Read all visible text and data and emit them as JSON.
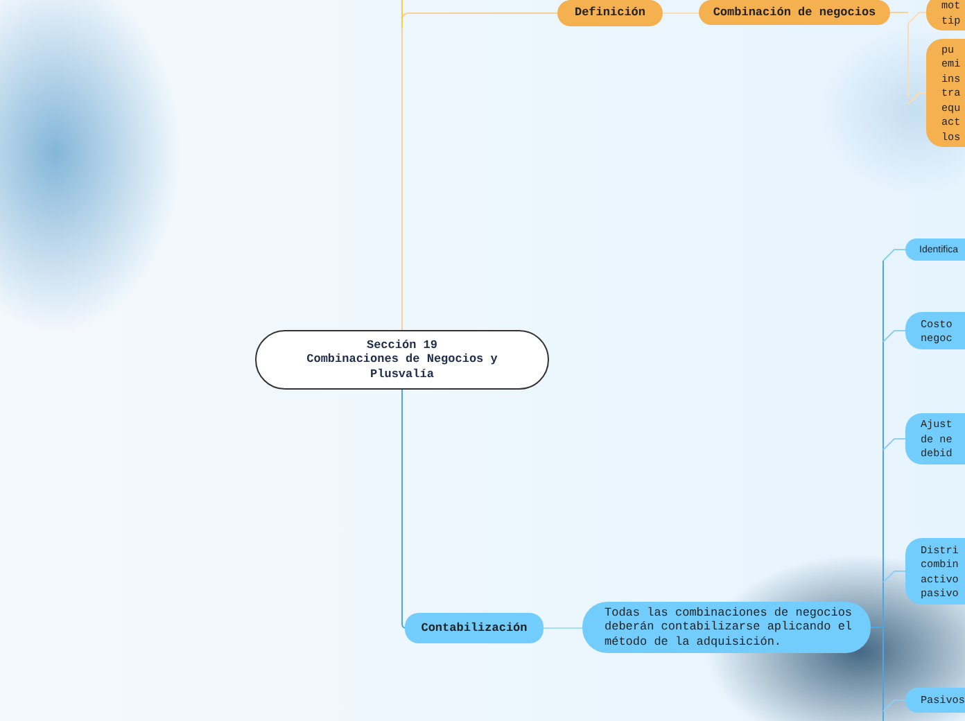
{
  "central_topic": {
    "lines": [
      "Sección 19",
      "Combinaciones de Negocios y",
      "Plusvalía"
    ]
  },
  "branches": [
    {
      "label": "Definición",
      "color": "#f5b04f",
      "children": [
        {
          "label": "Combinación de negocios",
          "children": [
            {
              "lines": [
                "mot",
                "tip"
              ]
            },
            {
              "lines": [
                "pu",
                "emi",
                "ins",
                "tra",
                "equ",
                "act",
                "los"
              ]
            }
          ]
        }
      ]
    },
    {
      "label": "Contabilización",
      "color": "#72cdfc",
      "children": [
        {
          "lines": [
            "Todas las combinaciones de negocios",
            "deberán contabilizarse aplicando el",
            "método de la adquisición."
          ],
          "children": [
            {
              "lines": [
                "Identifica"
              ]
            },
            {
              "lines": [
                "Costo",
                "negoc"
              ]
            },
            {
              "lines": [
                "Ajust",
                "de ne",
                "debid"
              ]
            },
            {
              "lines": [
                "Distri",
                "combin",
                "activo",
                "pasivo"
              ]
            },
            {
              "lines": [
                "Pasivos"
              ]
            }
          ]
        }
      ]
    }
  ]
}
